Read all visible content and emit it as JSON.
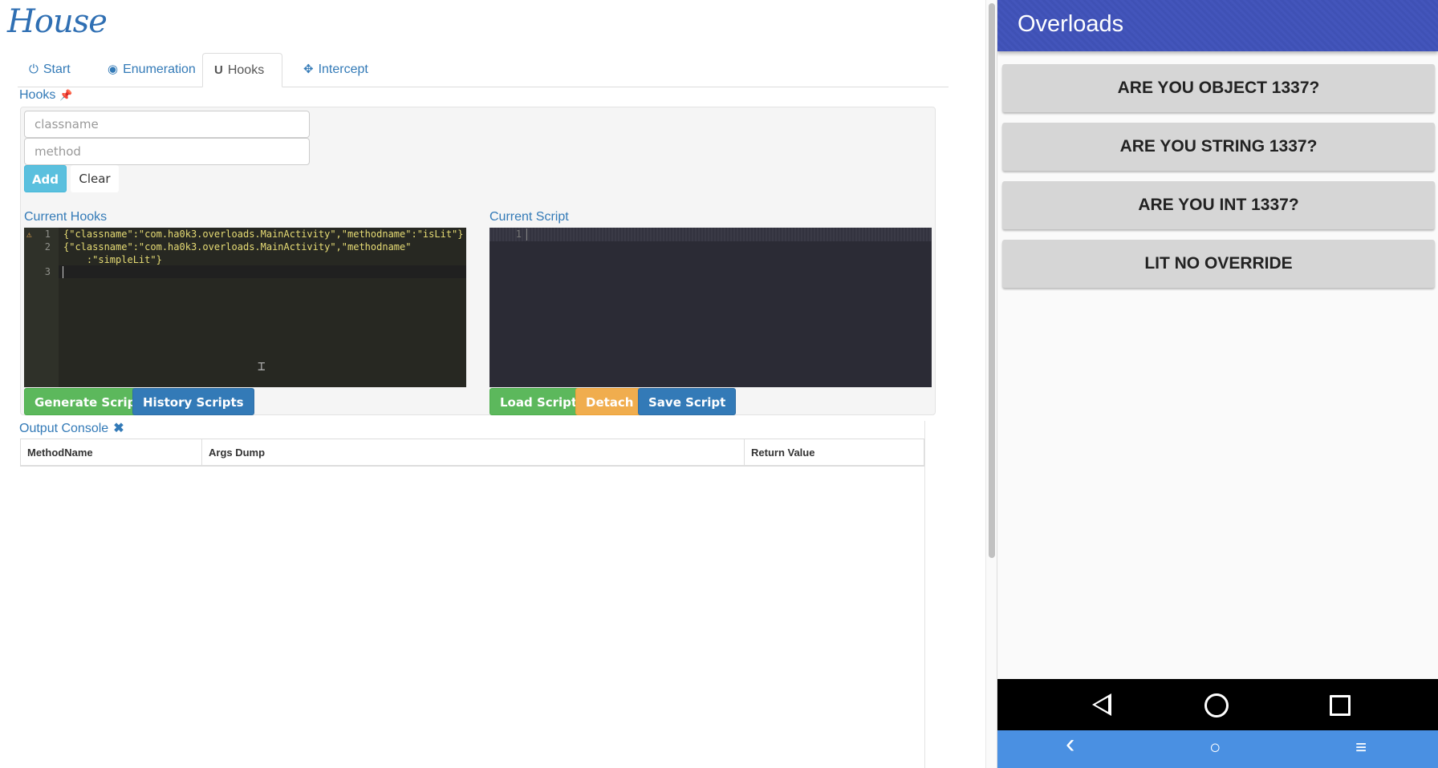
{
  "app": {
    "brand": "House"
  },
  "tabs": [
    {
      "label": "Start",
      "icon": "power-icon"
    },
    {
      "label": "Enumeration",
      "icon": "eye-icon"
    },
    {
      "label": "Hooks",
      "icon": "magnet-icon"
    },
    {
      "label": "Intercept",
      "icon": "crosshair-icon"
    }
  ],
  "hooks": {
    "title": "Hooks",
    "classname_placeholder": "classname",
    "method_placeholder": "method",
    "add_label": "Add",
    "clear_label": "Clear"
  },
  "current_hooks": {
    "title": "Current Hooks",
    "lines": [
      {
        "num": "1",
        "text": "{\"classname\":\"com.ha0k3.overloads.MainActivity\",\"methodname\":\"isLit\"}"
      },
      {
        "num": "2",
        "text": "{\"classname\":\"com.ha0k3.overloads.MainActivity\",\"methodname\""
      },
      {
        "num": "",
        "text": "    :\"simpleLit\"}"
      },
      {
        "num": "3",
        "text": ""
      }
    ],
    "generate_label": "Generate Script",
    "history_label": "History Scripts"
  },
  "current_script": {
    "title": "Current Script",
    "line_num": "1",
    "load_label": "Load Script",
    "detach_label": "Detach",
    "save_label": "Save Script"
  },
  "output_console": {
    "title": "Output Console",
    "columns": [
      "MethodName",
      "Args Dump",
      "Return Value"
    ]
  },
  "android": {
    "title": "Overloads",
    "buttons": [
      "ARE YOU OBJECT 1337?",
      "ARE YOU STRING 1337?",
      "ARE YOU INT 1337?",
      "LIT NO OVERRIDE"
    ],
    "host_nav": {
      "back": "‹",
      "home": "○",
      "menu": "≡"
    }
  },
  "colors": {
    "link_blue": "#337ab7",
    "app_bar": "#3f51b5",
    "host_bar": "#4a90e2",
    "success": "#5cb85c",
    "warning": "#f0ad4e",
    "info": "#5bc0de"
  }
}
